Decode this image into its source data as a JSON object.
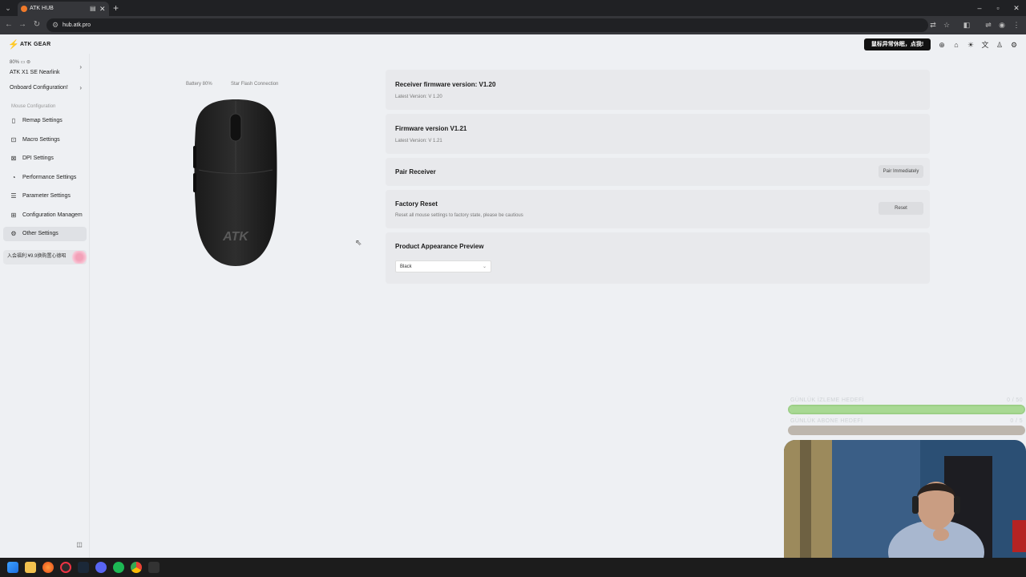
{
  "browser": {
    "tab_title": "ATK HUB",
    "url": "hub.atk.pro"
  },
  "header": {
    "logo_text": "ATK GEAR",
    "notice": "鼠标异常休眠，点我!"
  },
  "sidebar": {
    "device_status": "80% ▭ ⊜",
    "device_name": "ATK X1 SE Nearlink",
    "onboard": "Onboard Configuration!",
    "section_title": "Mouse Configuration",
    "items": [
      {
        "label": "Remap Settings",
        "icon": "mouse-icon"
      },
      {
        "label": "Macro Settings",
        "icon": "macro-icon"
      },
      {
        "label": "DPI Settings",
        "icon": "dpi-icon"
      },
      {
        "label": "Performance Settings",
        "icon": "performance-icon"
      },
      {
        "label": "Parameter Settings",
        "icon": "sliders-icon"
      },
      {
        "label": "Configuration Managem",
        "icon": "grid-icon"
      },
      {
        "label": "Other Settings",
        "icon": "gear-icon",
        "active": true
      }
    ],
    "promo": "入会福利:¥9.9换购置心德昭"
  },
  "mouse_info": {
    "battery": "Battery 80%",
    "connection": "Star Flash Connection"
  },
  "cards": {
    "receiver_fw": {
      "title": "Receiver firmware version: V1.20",
      "sub": "Latest Version: V 1.20"
    },
    "firmware": {
      "title": "Firmware version V1.21",
      "sub": "Latest Version: V 1.21"
    },
    "pair": {
      "title": "Pair Receiver",
      "button": "Pair Immediately"
    },
    "reset": {
      "title": "Factory Reset",
      "sub": "Reset all mouse settings to factory state, please be cautious",
      "button": "Reset"
    },
    "appearance": {
      "title": "Product Appearance Preview",
      "selected": "Black"
    }
  },
  "overlay": {
    "bar1": {
      "label": "GÜNLÜK İZLEME HEDEFİ",
      "value": "0 / 50",
      "progress": 1.0
    },
    "bar2": {
      "label": "GÜNLÜK ABONE HEDEFİ",
      "value": "0 / 5",
      "progress": 1.0
    }
  },
  "colors": {
    "accent": "#e35a1e",
    "notice_bg": "#111111",
    "progress_green": "#a8d993"
  }
}
